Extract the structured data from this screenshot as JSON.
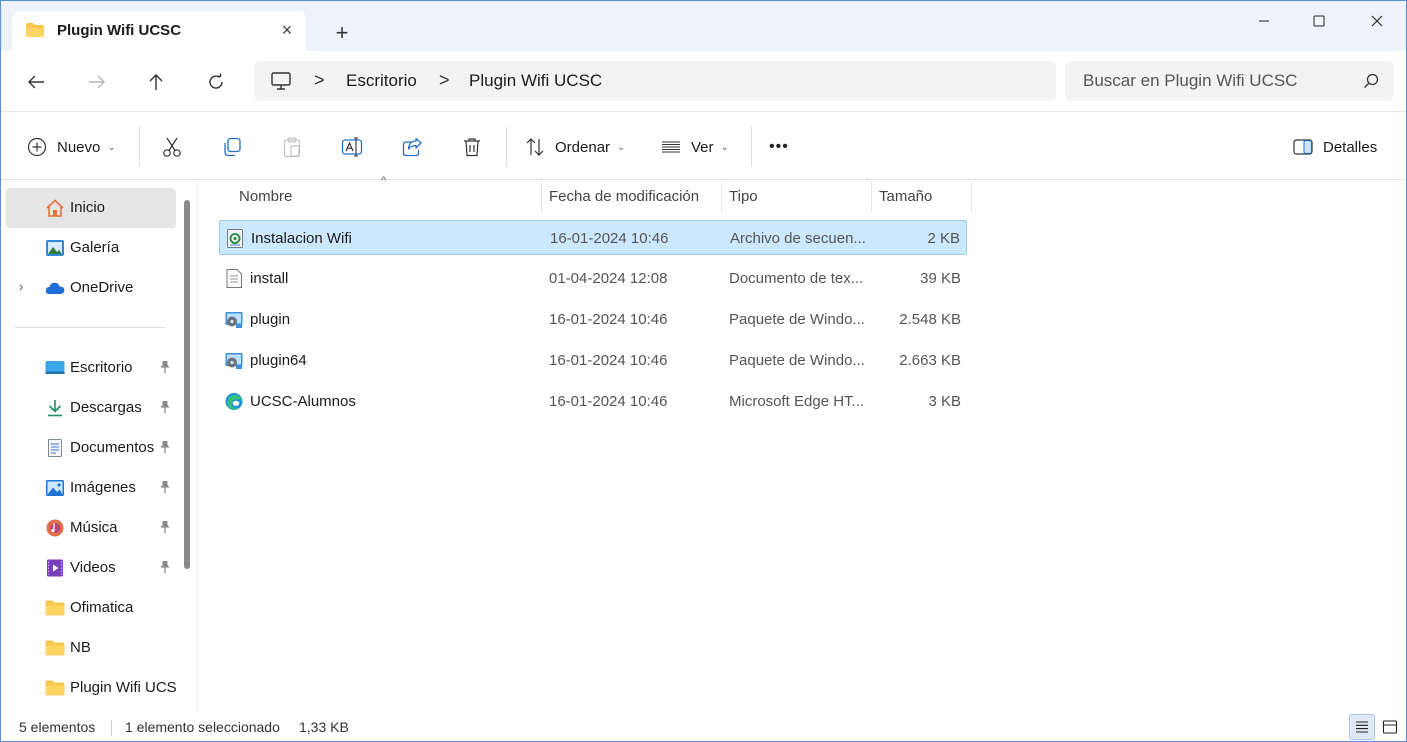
{
  "window": {
    "tab_title": "Plugin Wifi UCSC",
    "tab_icon": "folder-icon",
    "close_tab": "×",
    "new_tab": "+"
  },
  "address": {
    "crumbs": [
      "Escritorio",
      "Plugin Wifi UCSC"
    ],
    "separator": ">",
    "search_placeholder": "Buscar en Plugin Wifi UCSC"
  },
  "toolbar": {
    "new_label": "Nuevo",
    "sort_label": "Ordenar",
    "view_label": "Ver",
    "more_label": "•••",
    "details_label": "Detalles",
    "chevron": "⌄"
  },
  "sidebar": {
    "top_items": [
      {
        "label": "Inicio",
        "icon": "home-icon",
        "active": true
      },
      {
        "label": "Galería",
        "icon": "gallery-icon"
      },
      {
        "label": "OneDrive",
        "icon": "cloud-icon",
        "expander": "›"
      }
    ],
    "pinned_items": [
      {
        "label": "Escritorio",
        "icon": "desktop-icon",
        "pinned": true
      },
      {
        "label": "Descargas",
        "icon": "download-icon",
        "pinned": true
      },
      {
        "label": "Documentos",
        "icon": "document-icon",
        "pinned": true
      },
      {
        "label": "Imágenes",
        "icon": "image-icon",
        "pinned": true
      },
      {
        "label": "Música",
        "icon": "music-icon",
        "pinned": true
      },
      {
        "label": "Videos",
        "icon": "video-icon",
        "pinned": true
      },
      {
        "label": "Ofimatica",
        "icon": "folder-icon"
      },
      {
        "label": "NB",
        "icon": "folder-icon"
      },
      {
        "label": "Plugin Wifi UCSC",
        "icon": "folder-icon"
      }
    ]
  },
  "columns": {
    "name": "Nombre",
    "modified": "Fecha de modificación",
    "type": "Tipo",
    "size": "Tamaño",
    "sort_indicator": "^"
  },
  "files": [
    {
      "name": "Instalacion Wifi",
      "date": "16-01-2024 10:46",
      "type": "Archivo de secuen...",
      "size": "2 KB",
      "icon": "batch-file-icon",
      "selected": true
    },
    {
      "name": "install",
      "date": "01-04-2024 12:08",
      "type": "Documento de tex...",
      "size": "39 KB",
      "icon": "text-file-icon"
    },
    {
      "name": "plugin",
      "date": "16-01-2024 10:46",
      "type": "Paquete de Windo...",
      "size": "2.548 KB",
      "icon": "installer-package-icon"
    },
    {
      "name": "plugin64",
      "date": "16-01-2024 10:46",
      "type": "Paquete de Windo...",
      "size": "2.663 KB",
      "icon": "installer-package-icon"
    },
    {
      "name": "UCSC-Alumnos",
      "date": "16-01-2024 10:46",
      "type": "Microsoft Edge HT...",
      "size": "3 KB",
      "icon": "edge-icon"
    }
  ],
  "status": {
    "count": "5 elementos",
    "selection": "1 elemento seleccionado",
    "selection_size": "1,33 KB"
  },
  "colors": {
    "accent": "#0067c0",
    "selection_bg": "#cce8ff",
    "selection_border": "#99c9ef",
    "folder": "#f8c74a",
    "titlebar": "#eef3fb"
  }
}
